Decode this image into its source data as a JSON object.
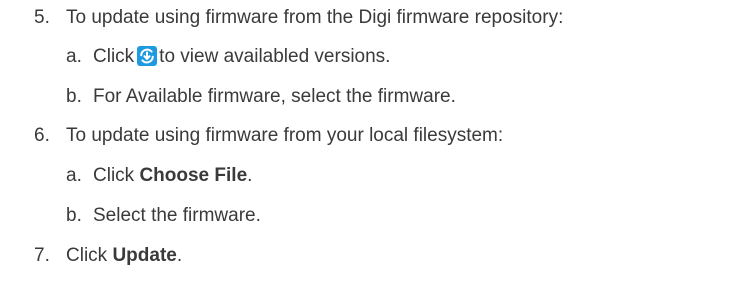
{
  "steps": [
    {
      "number": "5.",
      "text": "To update using firmware from the Digi firmware repository:",
      "substeps": [
        {
          "letter": "a.",
          "before": "Click",
          "icon": "refresh-download-icon",
          "after": "to view availabled versions."
        },
        {
          "letter": "b.",
          "text": "For Available firmware, select the firmware."
        }
      ]
    },
    {
      "number": "6.",
      "text": "To update using firmware from your local filesystem:",
      "substeps": [
        {
          "letter": "a.",
          "before": "Click",
          "bold": "Choose File",
          "after": "."
        },
        {
          "letter": "b.",
          "text": "Select the firmware."
        }
      ]
    },
    {
      "number": "7.",
      "before": "Click",
      "bold": "Update",
      "after": "."
    }
  ],
  "colors": {
    "text": "#3a3a3a",
    "icon_blue": "#1e9be0"
  }
}
